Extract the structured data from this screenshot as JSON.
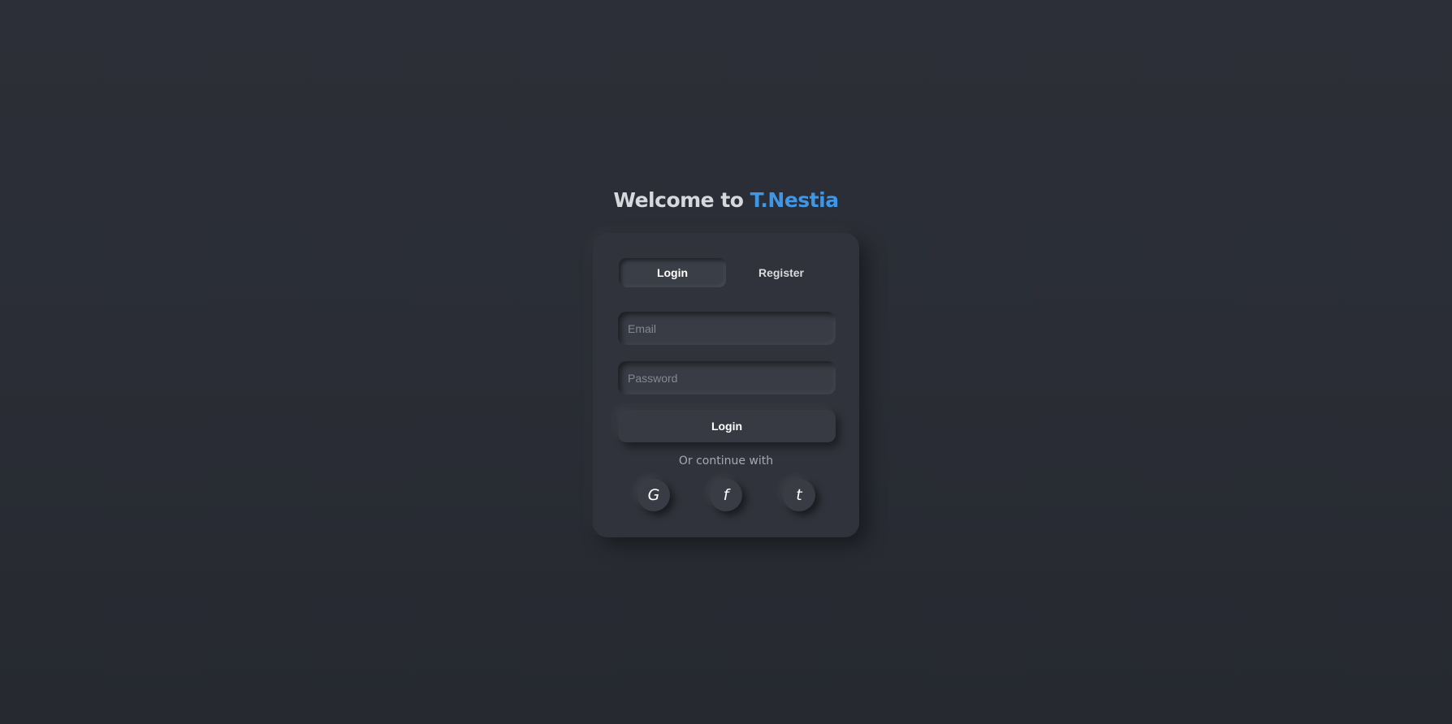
{
  "header": {
    "welcome_prefix": "Welcome to ",
    "brand_name": "T.Nestia",
    "brand_color": "#3f96e4"
  },
  "tabs": {
    "login_label": "Login",
    "register_label": "Register",
    "active": "Login"
  },
  "form": {
    "email_placeholder": "Email",
    "email_value": "",
    "password_placeholder": "Password",
    "password_value": "",
    "submit_label": "Login"
  },
  "social": {
    "continue_text": "Or continue with",
    "google_glyph": "G",
    "google_icon": "google-icon",
    "facebook_glyph": "f",
    "facebook_icon": "facebook-icon",
    "twitter_glyph": "t",
    "twitter_icon": "twitter-icon"
  },
  "colors": {
    "background": "#2a2d35",
    "card": "#30333b",
    "heading": "#d7d8db"
  }
}
